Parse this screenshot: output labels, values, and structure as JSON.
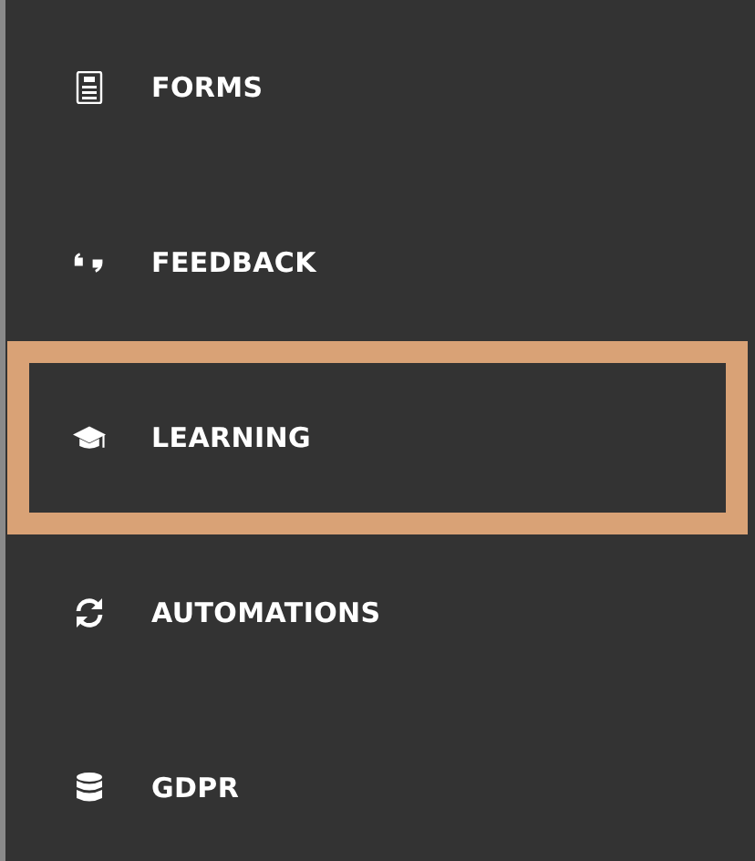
{
  "sidebar": {
    "items": [
      {
        "label": "FORMS",
        "kind": "forms",
        "selected": false
      },
      {
        "label": "FEEDBACK",
        "kind": "feedback",
        "selected": false
      },
      {
        "label": "LEARNING",
        "kind": "learning",
        "selected": true
      },
      {
        "label": "AUTOMATIONS",
        "kind": "automations",
        "selected": false
      },
      {
        "label": "GDPR",
        "kind": "gdpr",
        "selected": false
      }
    ]
  }
}
